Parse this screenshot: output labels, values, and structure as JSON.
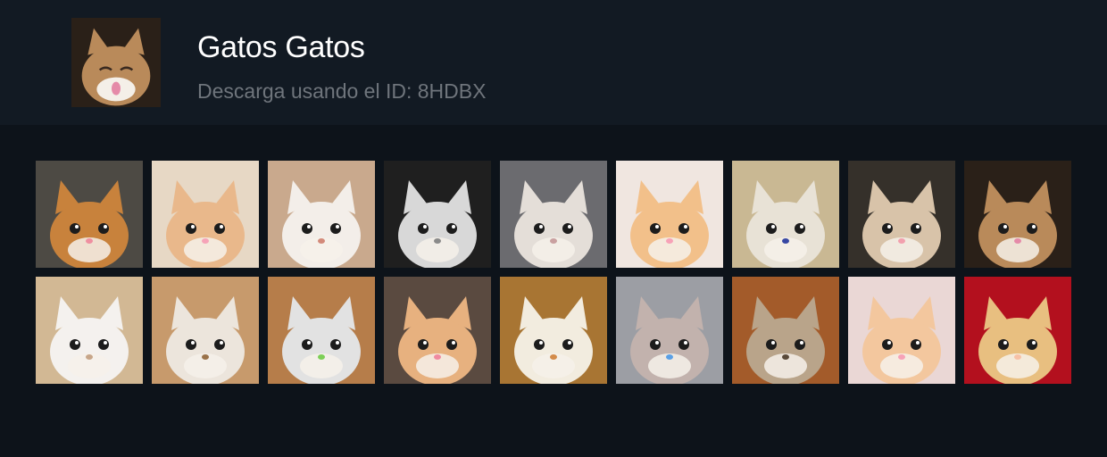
{
  "pack": {
    "title": "Gatos Gatos",
    "subtitle": "Descarga usando el ID: 8HDBX",
    "cover": {
      "icon": "cat-tongue-sticker",
      "bg": "#2a2018",
      "fur": "#b98a5a",
      "accent": "#e58aa8"
    }
  },
  "stickers": [
    {
      "name": "sticker-kissing-kittens",
      "bg": "#4d4a44",
      "fur": "#c8823c",
      "accent": "#ef8fa0"
    },
    {
      "name": "sticker-rainbow-cat",
      "bg": "#e7d8c5",
      "fur": "#e9b88b",
      "accent": "#f6a3b8"
    },
    {
      "name": "sticker-tongue-kitten",
      "bg": "#c9a98d",
      "fur": "#f3eee9",
      "accent": "#d38a7a"
    },
    {
      "name": "sticker-winking-kitten-bw",
      "bg": "#1f1f1f",
      "fur": "#d8d8d8",
      "accent": "#8a8a8a"
    },
    {
      "name": "sticker-scottish-fold",
      "bg": "#6b6b6f",
      "fur": "#e4ded8",
      "accent": "#c9a0a0"
    },
    {
      "name": "sticker-sleepy-orange-cat",
      "bg": "#f0e6e0",
      "fur": "#f2c08a",
      "accent": "#f7a2b7"
    },
    {
      "name": "sticker-fluffy-blue-eyes",
      "bg": "#c9b893",
      "fur": "#e8e2d6",
      "accent": "#3747a3"
    },
    {
      "name": "sticker-hahaha-no-meme",
      "bg": "#35302a",
      "fur": "#d8c3a9",
      "accent": "#f2a0ae"
    },
    {
      "name": "sticker-cat-tongue",
      "bg": "#2a2018",
      "fur": "#b98a5a",
      "accent": "#e58aa8"
    },
    {
      "name": "sticker-looking-up-kitten",
      "bg": "#d2b894",
      "fur": "#f4f1ee",
      "accent": "#c7a689"
    },
    {
      "name": "sticker-stairs-cat",
      "bg": "#c79a6c",
      "fur": "#ece5dc",
      "accent": "#9a7249"
    },
    {
      "name": "sticker-silver-tabby",
      "bg": "#b67d4a",
      "fur": "#e2e2e2",
      "accent": "#7ccf57"
    },
    {
      "name": "sticker-peeking-kitten",
      "bg": "#5a4a40",
      "fur": "#e7b17f",
      "accent": "#f08aa0"
    },
    {
      "name": "sticker-surprised-cat",
      "bg": "#a87533",
      "fur": "#f2ecdf",
      "accent": "#d38b4a"
    },
    {
      "name": "sticker-crying-gray-cat",
      "bg": "#9c9ea4",
      "fur": "#c2b2ad",
      "accent": "#5aa0e6"
    },
    {
      "name": "sticker-newspaper-glasses-cat",
      "bg": "#a35b2a",
      "fur": "#b9a48a",
      "accent": "#5a4a3a"
    },
    {
      "name": "sticker-blushing-sparkle-cat",
      "bg": "#ead7d5",
      "fur": "#f3c79e",
      "accent": "#f7a2b7"
    },
    {
      "name": "sticker-kittens-red-blanket",
      "bg": "#b3101e",
      "fur": "#e8bf80",
      "accent": "#f7c1a6"
    }
  ]
}
